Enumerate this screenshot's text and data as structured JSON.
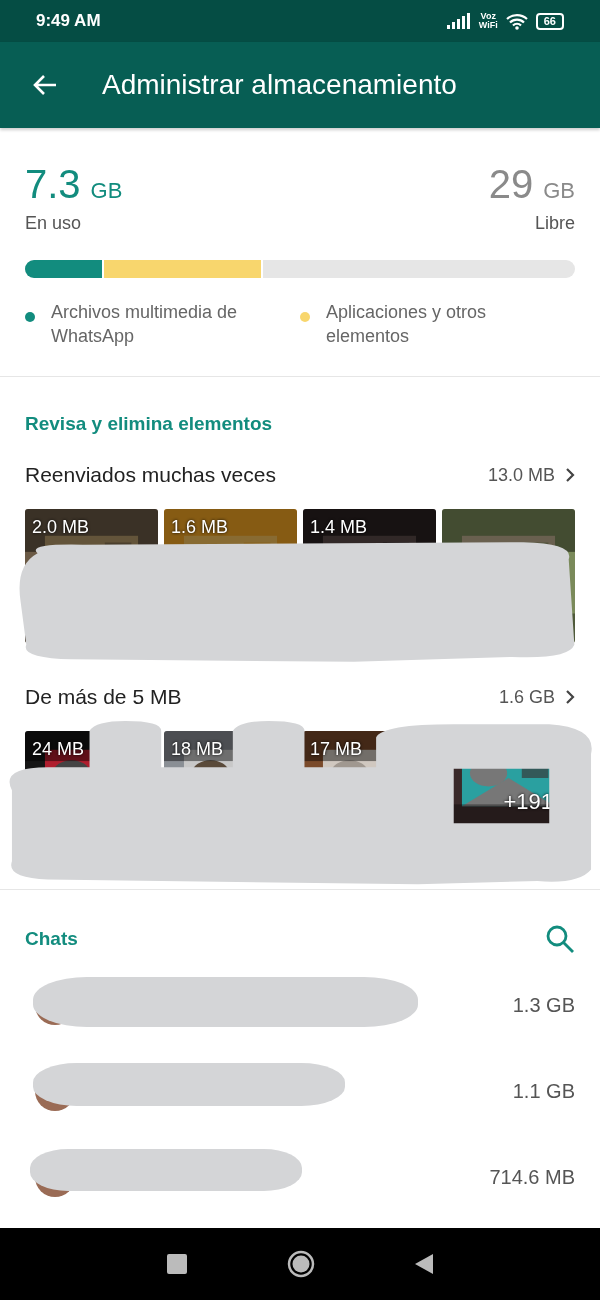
{
  "status_bar": {
    "time": "9:49 AM",
    "voz_wifi": "Voz\nWiFi",
    "battery": "66"
  },
  "app_bar": {
    "title": "Administrar almacenamiento"
  },
  "storage": {
    "used_value": "7.3",
    "used_unit": "GB",
    "used_label": "En uso",
    "free_value": "29",
    "free_unit": "GB",
    "free_label": "Libre",
    "bar": [
      {
        "color": "#128c7e",
        "level": 0.14
      },
      {
        "color": "#f8d66d",
        "level": 0.285
      }
    ],
    "legend": [
      {
        "label": "Archivos multimedia de WhatsApp",
        "color": "#128c7e"
      },
      {
        "label": "Aplicaciones y otros elementos",
        "color": "#f8d66d"
      }
    ]
  },
  "review": {
    "title": "Revisa y elimina elementos",
    "groups": [
      {
        "title": "Reenviados muchas veces",
        "size": "13.0 MB",
        "tiles": [
          {
            "size": "2.0 MB"
          },
          {
            "size": "1.6 MB"
          },
          {
            "size": "1.4 MB"
          },
          {
            "kind": "picture"
          }
        ]
      },
      {
        "title": "De más de 5 MB",
        "size": "1.6 GB",
        "tiles": [
          {
            "size": "24 MB"
          },
          {
            "size": "18 MB"
          },
          {
            "size": "17 MB"
          },
          {
            "size": "+191"
          }
        ]
      }
    ]
  },
  "chats": {
    "title": "Chats",
    "rows": [
      {
        "size": "1.3 GB"
      },
      {
        "size": "1.1 GB"
      },
      {
        "size": "714.6 MB"
      }
    ]
  }
}
